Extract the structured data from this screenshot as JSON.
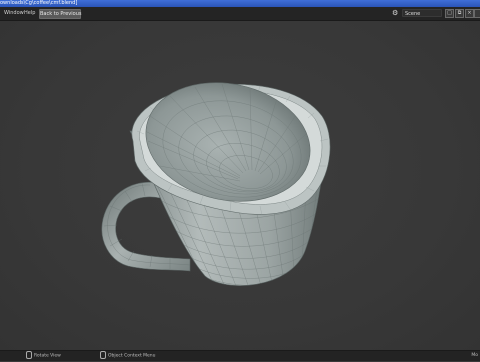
{
  "window": {
    "title": "ownloads\\Cg\\coffee\\cmf.blend]"
  },
  "topbar": {
    "menu_window": "Window",
    "menu_help": "Help",
    "back_button": "Back to Previous",
    "scene_label": "Scene"
  },
  "statusbar": {
    "rotate_view": "Rotate View",
    "context_menu": "Object Context Menu",
    "right_hint": "Mo"
  },
  "colors": {
    "titlebar": "#2a54b8",
    "viewport_bg": "#3a3a3a",
    "mesh_fill": "#9ea7a6",
    "wire": "#6f7a79"
  },
  "icons": [
    "scene-icon",
    "new-scene-icon",
    "copy-icon",
    "close-icon",
    "layer-icon",
    "mouse-icon"
  ]
}
